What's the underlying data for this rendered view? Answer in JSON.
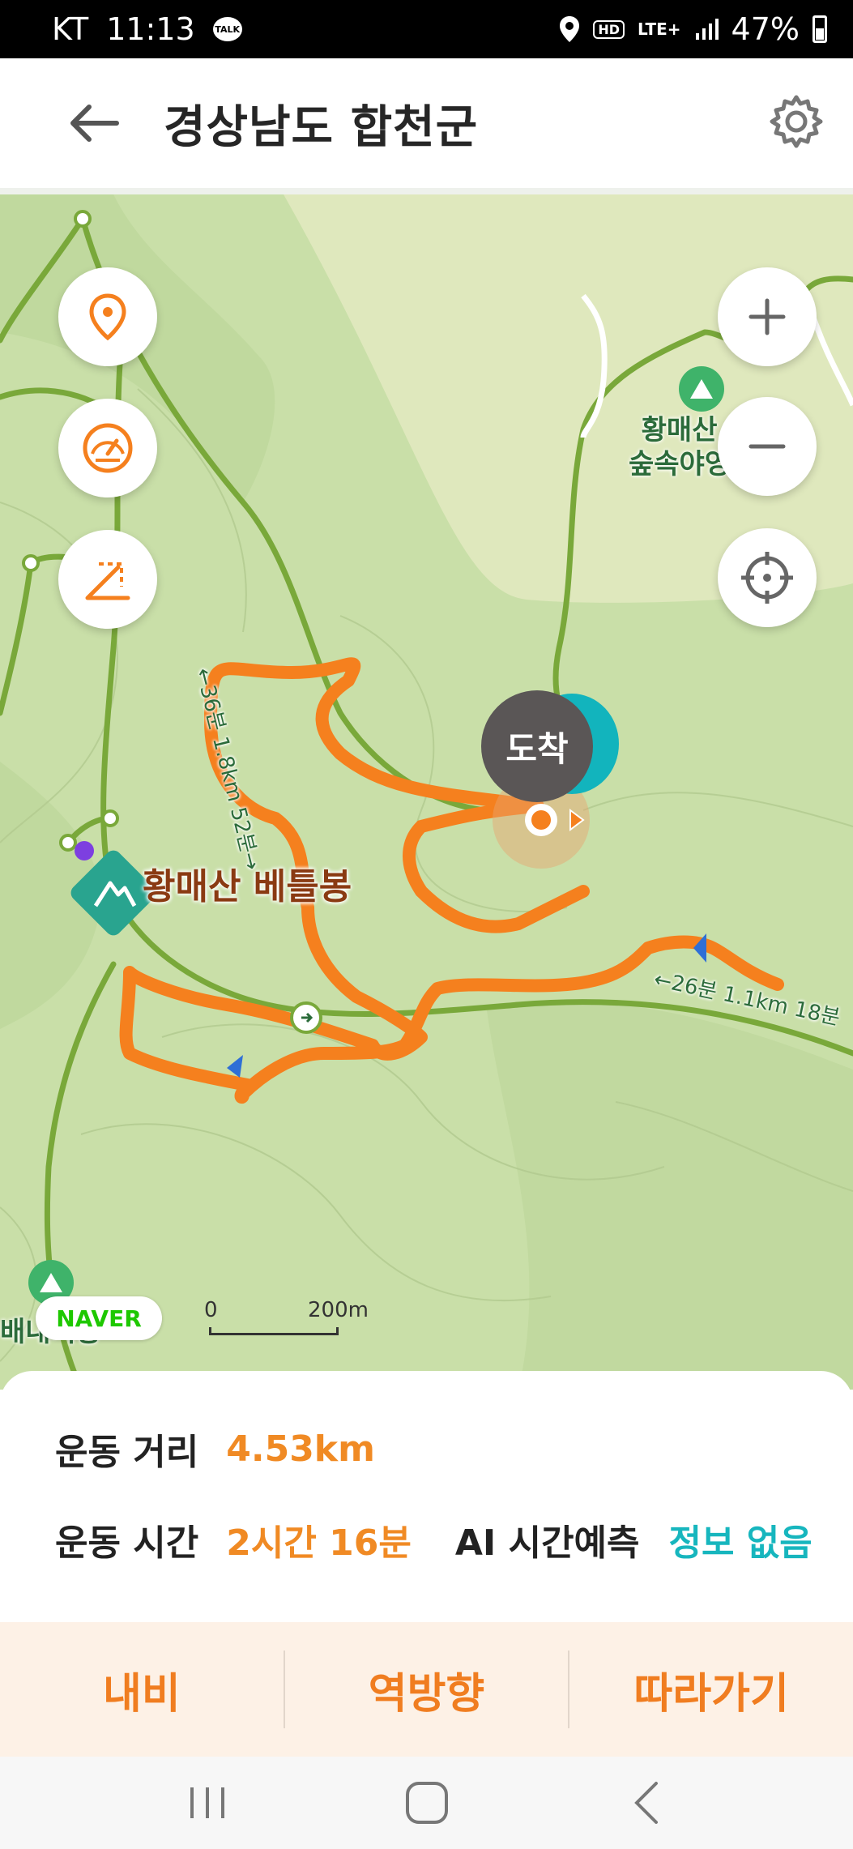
{
  "status_bar": {
    "carrier": "KT",
    "time": "11:13",
    "talk_badge": "TALK",
    "hd": "HD",
    "network": "LTE+",
    "battery": "47%"
  },
  "header": {
    "title": "경상남도 합천군",
    "back_icon": "arrow-left-icon",
    "settings_icon": "gear-icon"
  },
  "map": {
    "left_controls": [
      "location-pin-icon",
      "speedometer-icon",
      "slope-icon"
    ],
    "right_controls": [
      "zoom-in-icon",
      "zoom-out-icon",
      "crosshair-icon"
    ],
    "peak_label": "황매산 베틀봉",
    "camp_label_line1": "황매산",
    "camp_label_line2": "숲속야영",
    "trail_label_1": "←36분 1.8km 52분→",
    "trail_label_2": "←26분 1.1km 18분",
    "camp_label_bottom": "배내기봉",
    "arrival_label": "도착",
    "naver_logo": "NAVER",
    "scale_start": "0",
    "scale_end": "200m",
    "route_color": "#f5801e"
  },
  "info": {
    "distance_label": "운동 거리",
    "distance_value": "4.53km",
    "time_label": "운동 시간",
    "time_value": "2시간 16분",
    "ai_label": "AI 시간예측",
    "ai_value": "정보 없음"
  },
  "actions": {
    "navi": "내비",
    "reverse": "역방향",
    "follow": "따라가기"
  },
  "nav_bar": [
    "recent-apps-icon",
    "home-icon",
    "back-icon"
  ]
}
